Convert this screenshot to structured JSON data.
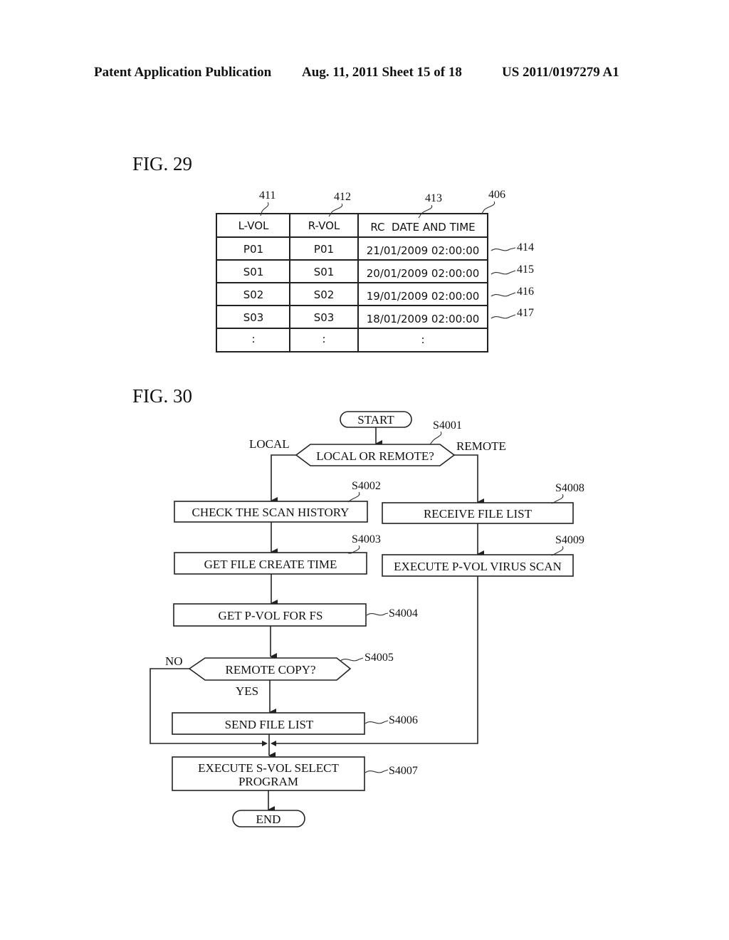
{
  "header": {
    "publication": "Patent Application Publication",
    "date_sheet": "Aug. 11, 2011  Sheet 15 of 18",
    "number": "US 2011/0197279 A1"
  },
  "fig29": {
    "title": "FIG. 29",
    "table_ref": "406",
    "columns": [
      {
        "label": "L-VOL",
        "ref": "411"
      },
      {
        "label": "R-VOL",
        "ref": "412"
      },
      {
        "label": "RC  DATE AND TIME",
        "ref": "413"
      }
    ],
    "rows": [
      {
        "cells": [
          "P01",
          "P01",
          "21/01/2009 02:00:00"
        ],
        "ref": "414"
      },
      {
        "cells": [
          "S01",
          "S01",
          "20/01/2009 02:00:00"
        ],
        "ref": "415"
      },
      {
        "cells": [
          "S02",
          "S02",
          "19/01/2009 02:00:00"
        ],
        "ref": "416"
      },
      {
        "cells": [
          "S03",
          "S03",
          "18/01/2009 02:00:00"
        ],
        "ref": "417"
      },
      {
        "cells": [
          ":",
          ":",
          ":"
        ],
        "ref": ""
      }
    ]
  },
  "fig30": {
    "title": "FIG. 30",
    "start": "START",
    "end": "END",
    "decision1": {
      "text": "LOCAL OR REMOTE?",
      "ref": "S4001",
      "left": "LOCAL",
      "right": "REMOTE"
    },
    "step_s4002": {
      "text": "CHECK THE SCAN HISTORY",
      "ref": "S4002"
    },
    "step_s4003": {
      "text": "GET FILE CREATE TIME",
      "ref": "S4003"
    },
    "step_s4004": {
      "text": "GET P-VOL FOR FS",
      "ref": "S4004"
    },
    "decision2": {
      "text": "REMOTE COPY?",
      "ref": "S4005",
      "no": "NO",
      "yes": "YES"
    },
    "step_s4006": {
      "text": "SEND FILE LIST",
      "ref": "S4006"
    },
    "step_s4007": {
      "line1": "EXECUTE S-VOL SELECT",
      "line2": "PROGRAM",
      "ref": "S4007"
    },
    "step_s4008": {
      "text": "RECEIVE FILE LIST",
      "ref": "S4008"
    },
    "step_s4009": {
      "text": "EXECUTE P-VOL VIRUS SCAN",
      "ref": "S4009"
    }
  }
}
